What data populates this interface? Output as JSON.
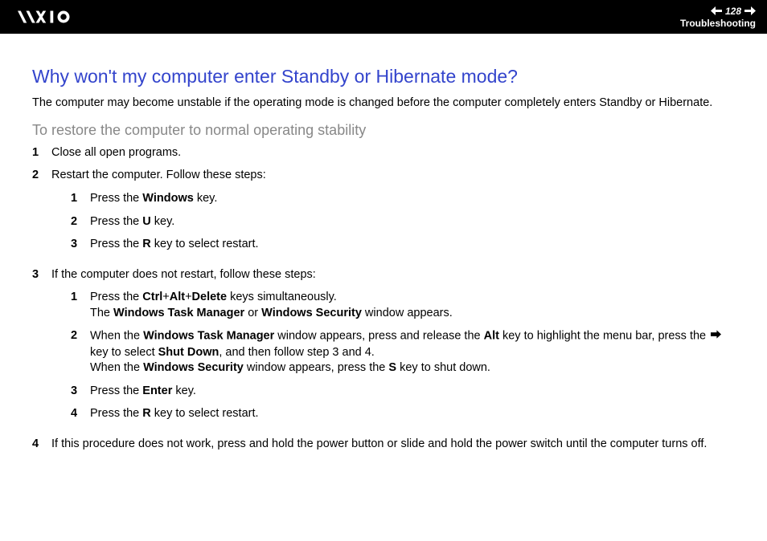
{
  "header": {
    "page_number": "128",
    "section": "Troubleshooting"
  },
  "question": "Why won't my computer enter Standby or Hibernate mode?",
  "intro": "The computer may become unstable if the operating mode is changed before the computer completely enters Standby or Hibernate.",
  "subtitle": "To restore the computer to normal operating stability",
  "steps": {
    "s1": {
      "num": "1",
      "text": "Close all open programs."
    },
    "s2": {
      "num": "2",
      "text": "Restart the computer. Follow these steps:"
    },
    "s2_1": {
      "num": "1",
      "pre": "Press the ",
      "b1": "Windows",
      "post": " key."
    },
    "s2_2": {
      "num": "2",
      "pre": "Press the ",
      "b1": "U",
      "post": " key."
    },
    "s2_3": {
      "num": "3",
      "pre": "Press the ",
      "b1": "R",
      "post": " key to select restart."
    },
    "s3": {
      "num": "3",
      "text": "If the computer does not restart, follow these steps:"
    },
    "s3_1": {
      "num": "1",
      "line1_pre": "Press the ",
      "line1_b1": "Ctrl",
      "line1_mid1": "+",
      "line1_b2": "Alt",
      "line1_mid2": "+",
      "line1_b3": "Delete",
      "line1_post": " keys simultaneously.",
      "line2_pre": "The ",
      "line2_b1": "Windows Task Manager",
      "line2_mid": " or ",
      "line2_b2": "Windows Security",
      "line2_post": " window appears."
    },
    "s3_2": {
      "num": "2",
      "l1_pre": "When the ",
      "l1_b1": "Windows Task Manager",
      "l1_mid1": " window appears, press and release the ",
      "l1_b2": "Alt",
      "l1_mid2": " key to highlight the menu bar, press the ",
      "l1_mid3": " key to select ",
      "l1_b3": "Shut Down",
      "l1_post": ", and then follow step 3 and 4.",
      "l2_pre": "When the ",
      "l2_b1": "Windows Security",
      "l2_mid": " window appears, press the ",
      "l2_b2": "S",
      "l2_post": " key to shut down."
    },
    "s3_3": {
      "num": "3",
      "pre": "Press the ",
      "b1": "Enter",
      "post": " key."
    },
    "s3_4": {
      "num": "4",
      "pre": "Press the ",
      "b1": "R",
      "post": " key to select restart."
    },
    "s4": {
      "num": "4",
      "text": "If this procedure does not work, press and hold the power button or slide and hold the power switch until the computer turns off."
    }
  }
}
